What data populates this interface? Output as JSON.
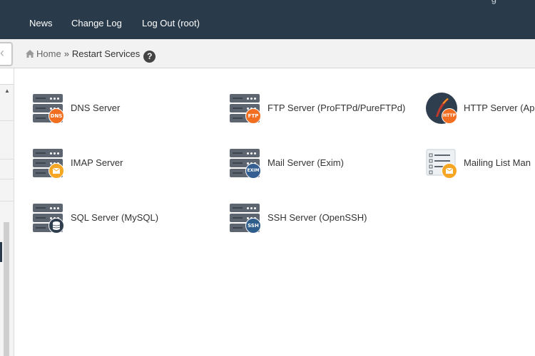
{
  "topnav": {
    "items": [
      {
        "label": "News"
      },
      {
        "label": "Change Log"
      },
      {
        "label": "Log Out (root)"
      }
    ],
    "corner_partial": "g"
  },
  "breadcrumb": {
    "home": "Home",
    "separator": "»",
    "current": "Restart Services",
    "help": "?"
  },
  "services": [
    {
      "label": "DNS Server",
      "badge": "DNS",
      "badge_color": "#f26f21"
    },
    {
      "label": "FTP Server (ProFTPd/PureFTPd)",
      "badge": "FTP",
      "badge_color": "#f26f21"
    },
    {
      "label": "HTTP Server (Ap",
      "badge": "HTTP",
      "badge_color": "#f26f21"
    },
    {
      "label": "IMAP Server",
      "badge": "",
      "badge_color": "#f6a623"
    },
    {
      "label": "Mail Server (Exim)",
      "badge": "EXIM",
      "badge_color": "#355f92"
    },
    {
      "label": "Mailing List Man",
      "badge": "",
      "badge_color": "#f6a623"
    },
    {
      "label": "SQL Server (MySQL)",
      "badge": "",
      "badge_color": "#2f3e4e"
    },
    {
      "label": "SSH Server (OpenSSH)",
      "badge": "SSH",
      "badge_color": "#2f5d8c"
    }
  ],
  "colors": {
    "topbar": "#293a4a",
    "server_gray": "#5d6670",
    "accent_orange": "#f26f21"
  },
  "icons": [
    "home-icon",
    "help-icon",
    "server-icon",
    "apache-feather-icon",
    "mailing-list-icon"
  ]
}
